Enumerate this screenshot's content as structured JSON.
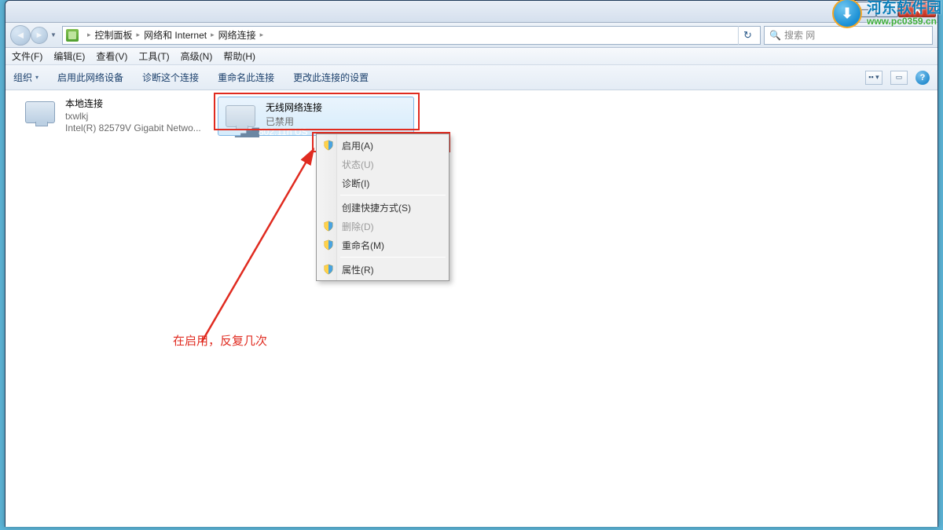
{
  "titlebar": {
    "min": "—",
    "max": "❐",
    "close": "X"
  },
  "address": {
    "crumbs": [
      "控制面板",
      "网络和 Internet",
      "网络连接"
    ],
    "search_placeholder": "搜索 网"
  },
  "menus": [
    "文件(F)",
    "编辑(E)",
    "查看(V)",
    "工具(T)",
    "高级(N)",
    "帮助(H)"
  ],
  "toolbar": {
    "organize": "组织",
    "items": [
      "启用此网络设备",
      "诊断这个连接",
      "重命名此连接",
      "更改此连接的设置"
    ]
  },
  "connections": [
    {
      "title": "本地连接",
      "line2": "txwlkj",
      "line3": "Intel(R) 82579V Gigabit Netwo..."
    },
    {
      "title": "无线网络连接",
      "line2": "已禁用",
      "line3": "802.11n US"
    }
  ],
  "context_menu": [
    {
      "label": "启用(A)",
      "shield": true,
      "disabled": false
    },
    {
      "label": "状态(U)",
      "shield": false,
      "disabled": true
    },
    {
      "label": "诊断(I)",
      "shield": false,
      "disabled": false
    },
    {
      "sep": true
    },
    {
      "label": "创建快捷方式(S)",
      "shield": false,
      "disabled": false
    },
    {
      "label": "删除(D)",
      "shield": true,
      "disabled": true
    },
    {
      "label": "重命名(M)",
      "shield": true,
      "disabled": false
    },
    {
      "sep": true
    },
    {
      "label": "属性(R)",
      "shield": true,
      "disabled": false
    }
  ],
  "annotation": "在启用，反复几次",
  "watermark": {
    "name": "河东软件园",
    "url": "www.pc0359.cn"
  }
}
